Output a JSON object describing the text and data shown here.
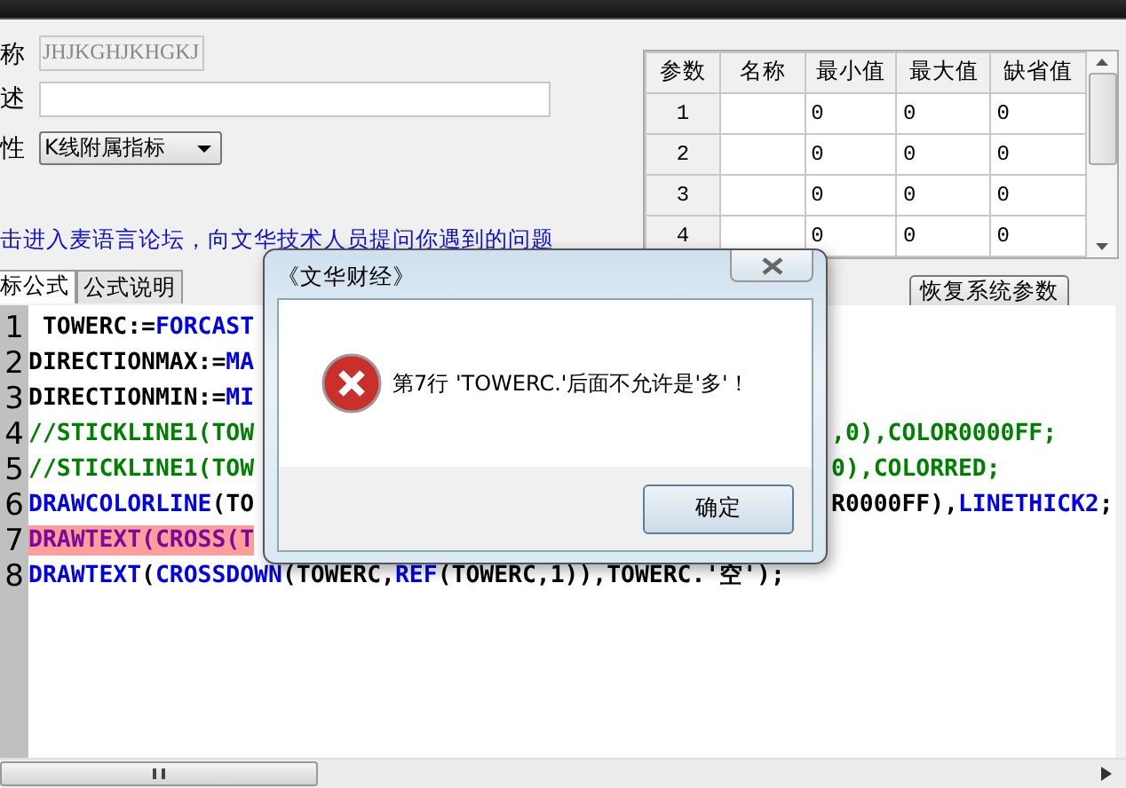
{
  "form": {
    "labels": [
      "称",
      "述",
      "性"
    ],
    "name_field": {
      "value": "JHJKGHJKHGKJ",
      "disabled": true
    },
    "type_select": {
      "value": "K线附属指标"
    },
    "forum_link": "击进入麦语言论坛，向文华技术人员提问你遇到的问题"
  },
  "tabs": [
    {
      "label": "标公式",
      "selected": true
    },
    {
      "label": "公式说明",
      "selected": false
    }
  ],
  "params_table": {
    "columns": [
      "参数",
      "名称",
      "最小值",
      "最大值",
      "缺省值"
    ],
    "rows": [
      {
        "index": "1",
        "min": "0",
        "max": "0",
        "default": "0"
      },
      {
        "index": "2",
        "min": "0",
        "max": "0",
        "default": "0"
      },
      {
        "index": "3",
        "min": "0",
        "max": "0",
        "default": "0"
      },
      {
        "index": "4",
        "min": "0",
        "max": "0",
        "default": "0"
      }
    ]
  },
  "restore_button": "恢复系统参数",
  "code_lines": [
    {
      "number": "1",
      "error": false,
      "left": [
        {
          "kind": "ident",
          "text": " TOWERC:="
        },
        {
          "kind": "func",
          "text": "FORCAST"
        }
      ]
    },
    {
      "number": "2",
      "error": false,
      "left": [
        {
          "kind": "ident",
          "text": "DIRECTIONMAX:="
        },
        {
          "kind": "func",
          "text": "MA"
        }
      ]
    },
    {
      "number": "3",
      "error": false,
      "left": [
        {
          "kind": "ident",
          "text": "DIRECTIONMIN:="
        },
        {
          "kind": "func",
          "text": "MI"
        }
      ]
    },
    {
      "number": "4",
      "error": false,
      "left": [
        {
          "kind": "comment",
          "text": "//STICKLINE1(TOW"
        }
      ],
      "right": [
        {
          "kind": "comment",
          "text": ",0),COLOR0000FF;"
        }
      ]
    },
    {
      "number": "5",
      "error": false,
      "left": [
        {
          "kind": "comment",
          "text": "//STICKLINE1(TOW"
        }
      ],
      "right": [
        {
          "kind": "comment",
          "text": "0),COLORRED;"
        }
      ]
    },
    {
      "number": "6",
      "error": false,
      "left": [
        {
          "kind": "func",
          "text": "DRAWCOLORLINE"
        },
        {
          "kind": "ident",
          "text": "(TO"
        }
      ],
      "right": [
        {
          "kind": "ident",
          "text": "R0000FF),"
        },
        {
          "kind": "func",
          "text": "LINETHICK2"
        },
        {
          "kind": "ident",
          "text": ";"
        }
      ]
    },
    {
      "number": "7",
      "error": true,
      "left": [
        {
          "kind": "ident",
          "text": "DRAWTEXT(CROSS(T"
        }
      ]
    },
    {
      "number": "8",
      "error": false,
      "left": [
        {
          "kind": "func",
          "text": "DRAWTEXT"
        },
        {
          "kind": "ident",
          "text": "("
        },
        {
          "kind": "func",
          "text": "CROSSDOWN"
        },
        {
          "kind": "ident",
          "text": "(TOWERC,"
        },
        {
          "kind": "func",
          "text": "REF"
        },
        {
          "kind": "ident",
          "text": "(TOWERC,1)),TOWERC.'空');"
        }
      ]
    }
  ],
  "dialog": {
    "title": "《文华财经》",
    "message": "第7行 'TOWERC.'后面不允许是'多'！",
    "ok_button": "确定"
  }
}
